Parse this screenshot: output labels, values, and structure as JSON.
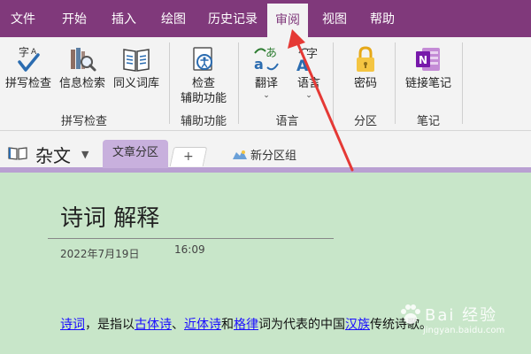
{
  "menu": {
    "tabs": [
      {
        "label": "文件"
      },
      {
        "label": "开始"
      },
      {
        "label": "插入"
      },
      {
        "label": "绘图"
      },
      {
        "label": "历史记录"
      },
      {
        "label": "审阅"
      },
      {
        "label": "视图"
      },
      {
        "label": "帮助"
      }
    ],
    "active_index": 5
  },
  "ribbon": {
    "buttons": {
      "spelling": "拼写检查",
      "research": "信息检索",
      "thesaurus": "同义词库",
      "check_accessibility": "检查\n辅助功能",
      "translate": "翻译",
      "language": "语言",
      "password": "密码",
      "linked_notes": "链接笔记"
    },
    "groups": {
      "proofing": "拼写检查",
      "accessibility": "辅助功能",
      "language": "语言",
      "section": "分区",
      "notes": "笔记"
    }
  },
  "notebook": {
    "title": "杂文",
    "section_tab": "文章分区",
    "add_tab": "+",
    "section_group": "新分区组"
  },
  "page": {
    "title": "诗词 解释",
    "date": "2022年7月19日",
    "time": "16:09",
    "body": {
      "link1": "诗词",
      "t1": "，是指以",
      "link2": "古体诗",
      "t2": "、",
      "link3": "近体诗",
      "t3": "和",
      "link4": "格律",
      "t4": "词为代表的中国",
      "link5": "汉族",
      "t5": "传统诗歌。"
    }
  },
  "watermark": {
    "main": "Bai 经验",
    "sub": "jingyan.baidu.com"
  },
  "colors": {
    "menubar": "#80397b",
    "ribbon": "#f3f3f3",
    "page_bg": "#c8e6c9",
    "section_tab": "#c8b0dd",
    "arrow": "#e53935",
    "link": "#1a0dff"
  }
}
